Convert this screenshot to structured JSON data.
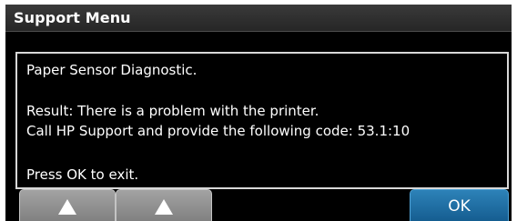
{
  "title": "Support Menu",
  "message": {
    "line1": "Paper Sensor Diagnostic.",
    "line2": "Result: There is a problem with the printer.",
    "line3": "Call HP Support and provide the following code: 53.1:10",
    "line4": "Press OK to exit."
  },
  "buttons": {
    "up1_icon": "up-arrow-icon",
    "up2_icon": "up-arrow-icon",
    "ok_label": "OK"
  },
  "colors": {
    "screen_bg": "#000000",
    "ok_button": "#1d6fa5",
    "arrow_button": "#8f8f8f",
    "text": "#ffffff"
  }
}
